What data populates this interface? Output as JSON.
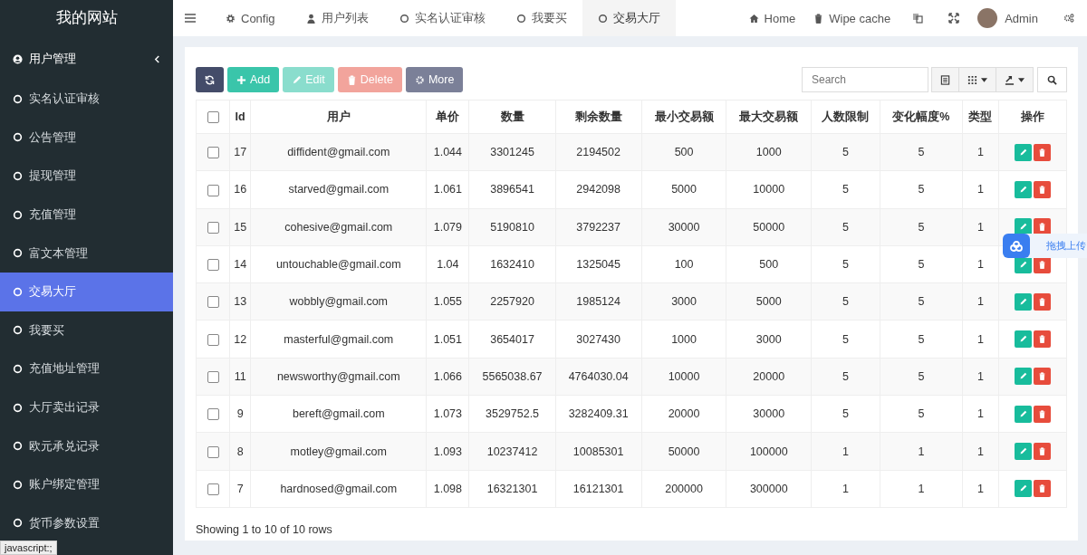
{
  "brand": "我的网站",
  "sidebar": {
    "items": [
      {
        "label": "用户管理",
        "kind": "group",
        "selected": false
      },
      {
        "label": "实名认证审核",
        "kind": "item",
        "selected": false
      },
      {
        "label": "公告管理",
        "kind": "item",
        "selected": false
      },
      {
        "label": "提现管理",
        "kind": "item",
        "selected": false
      },
      {
        "label": "充值管理",
        "kind": "item",
        "selected": false
      },
      {
        "label": "富文本管理",
        "kind": "item",
        "selected": false
      },
      {
        "label": "交易大厅",
        "kind": "item",
        "selected": true
      },
      {
        "label": "我要买",
        "kind": "item",
        "selected": false
      },
      {
        "label": "充值地址管理",
        "kind": "item",
        "selected": false
      },
      {
        "label": "大厅卖出记录",
        "kind": "item",
        "selected": false
      },
      {
        "label": "欧元承兑记录",
        "kind": "item",
        "selected": false
      },
      {
        "label": "账户绑定管理",
        "kind": "item",
        "selected": false
      },
      {
        "label": "货币参数设置",
        "kind": "item",
        "selected": false
      }
    ]
  },
  "tabs": [
    {
      "label": "Config",
      "selected": false
    },
    {
      "label": "用户列表",
      "selected": false
    },
    {
      "label": "实名认证审核",
      "selected": false
    },
    {
      "label": "我要买",
      "selected": false
    },
    {
      "label": "交易大厅",
      "selected": true
    }
  ],
  "header_links": [
    {
      "label": "Home"
    },
    {
      "label": "Wipe cache"
    }
  ],
  "user": {
    "name": "Admin"
  },
  "toolbar": [
    {
      "kind": "refresh",
      "disabled": false
    },
    {
      "kind": "add",
      "label": "Add",
      "disabled": false
    },
    {
      "kind": "edit",
      "label": "Edit",
      "disabled": true
    },
    {
      "kind": "delete",
      "label": "Delete",
      "disabled": true
    },
    {
      "kind": "more",
      "label": "More",
      "disabled": false
    }
  ],
  "search": {
    "placeholder": "Search"
  },
  "table": {
    "all_checked": false,
    "columns": [
      "Id",
      "用户",
      "单价",
      "数量",
      "剩余数量",
      "最小交易额",
      "最大交易额",
      "人数限制",
      "变化幅度%",
      "类型",
      "操作"
    ],
    "rows": [
      {
        "checked": false,
        "cells": [
          "17",
          "diffident@gmail.com",
          "1.044",
          "3301245",
          "2194502",
          "500",
          "1000",
          "5",
          "5",
          "1"
        ]
      },
      {
        "checked": false,
        "cells": [
          "16",
          "starved@gmail.com",
          "1.061",
          "3896541",
          "2942098",
          "5000",
          "10000",
          "5",
          "5",
          "1"
        ]
      },
      {
        "checked": false,
        "cells": [
          "15",
          "cohesive@gmail.com",
          "1.079",
          "5190810",
          "3792237",
          "30000",
          "50000",
          "5",
          "5",
          "1"
        ]
      },
      {
        "checked": false,
        "cells": [
          "14",
          "untouchable@gmail.com",
          "1.04",
          "1632410",
          "1325045",
          "100",
          "500",
          "5",
          "5",
          "1"
        ]
      },
      {
        "checked": false,
        "cells": [
          "13",
          "wobbly@gmail.com",
          "1.055",
          "2257920",
          "1985124",
          "3000",
          "5000",
          "5",
          "5",
          "1"
        ]
      },
      {
        "checked": false,
        "cells": [
          "12",
          "masterful@gmail.com",
          "1.051",
          "3654017",
          "3027430",
          "1000",
          "3000",
          "5",
          "5",
          "1"
        ]
      },
      {
        "checked": false,
        "cells": [
          "11",
          "newsworthy@gmail.com",
          "1.066",
          "5565038.67",
          "4764030.04",
          "10000",
          "20000",
          "5",
          "5",
          "1"
        ]
      },
      {
        "checked": false,
        "cells": [
          "9",
          "bereft@gmail.com",
          "1.073",
          "3529752.5",
          "3282409.31",
          "20000",
          "30000",
          "5",
          "5",
          "1"
        ]
      },
      {
        "checked": false,
        "cells": [
          "8",
          "motley@gmail.com",
          "1.093",
          "10237412",
          "10085301",
          "50000",
          "100000",
          "1",
          "1",
          "1"
        ]
      },
      {
        "checked": false,
        "cells": [
          "7",
          "hardnosed@gmail.com",
          "1.098",
          "16321301",
          "16121301",
          "200000",
          "300000",
          "1",
          "1",
          "1"
        ]
      }
    ]
  },
  "pagination_info": "Showing 1 to 10 of 10 rows",
  "upload_widget": {
    "label": "拖拽上传"
  },
  "status_bar": "javascript:;"
}
